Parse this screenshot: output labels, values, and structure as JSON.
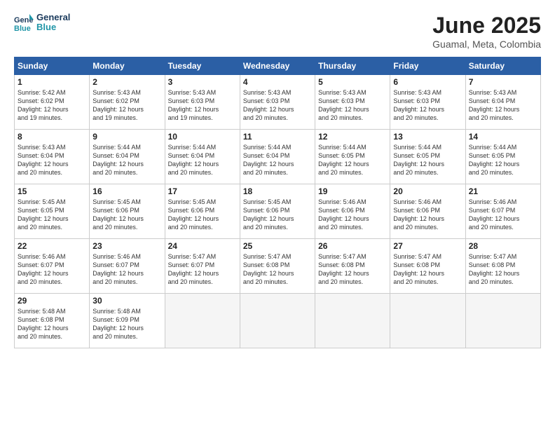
{
  "logo": {
    "line1": "General",
    "line2": "Blue"
  },
  "title": "June 2025",
  "location": "Guamal, Meta, Colombia",
  "weekdays": [
    "Sunday",
    "Monday",
    "Tuesday",
    "Wednesday",
    "Thursday",
    "Friday",
    "Saturday"
  ],
  "weeks": [
    [
      {
        "day": "1",
        "text": "Sunrise: 5:42 AM\nSunset: 6:02 PM\nDaylight: 12 hours\nand 19 minutes."
      },
      {
        "day": "2",
        "text": "Sunrise: 5:43 AM\nSunset: 6:02 PM\nDaylight: 12 hours\nand 19 minutes."
      },
      {
        "day": "3",
        "text": "Sunrise: 5:43 AM\nSunset: 6:03 PM\nDaylight: 12 hours\nand 19 minutes."
      },
      {
        "day": "4",
        "text": "Sunrise: 5:43 AM\nSunset: 6:03 PM\nDaylight: 12 hours\nand 20 minutes."
      },
      {
        "day": "5",
        "text": "Sunrise: 5:43 AM\nSunset: 6:03 PM\nDaylight: 12 hours\nand 20 minutes."
      },
      {
        "day": "6",
        "text": "Sunrise: 5:43 AM\nSunset: 6:03 PM\nDaylight: 12 hours\nand 20 minutes."
      },
      {
        "day": "7",
        "text": "Sunrise: 5:43 AM\nSunset: 6:04 PM\nDaylight: 12 hours\nand 20 minutes."
      }
    ],
    [
      {
        "day": "8",
        "text": "Sunrise: 5:43 AM\nSunset: 6:04 PM\nDaylight: 12 hours\nand 20 minutes."
      },
      {
        "day": "9",
        "text": "Sunrise: 5:44 AM\nSunset: 6:04 PM\nDaylight: 12 hours\nand 20 minutes."
      },
      {
        "day": "10",
        "text": "Sunrise: 5:44 AM\nSunset: 6:04 PM\nDaylight: 12 hours\nand 20 minutes."
      },
      {
        "day": "11",
        "text": "Sunrise: 5:44 AM\nSunset: 6:04 PM\nDaylight: 12 hours\nand 20 minutes."
      },
      {
        "day": "12",
        "text": "Sunrise: 5:44 AM\nSunset: 6:05 PM\nDaylight: 12 hours\nand 20 minutes."
      },
      {
        "day": "13",
        "text": "Sunrise: 5:44 AM\nSunset: 6:05 PM\nDaylight: 12 hours\nand 20 minutes."
      },
      {
        "day": "14",
        "text": "Sunrise: 5:44 AM\nSunset: 6:05 PM\nDaylight: 12 hours\nand 20 minutes."
      }
    ],
    [
      {
        "day": "15",
        "text": "Sunrise: 5:45 AM\nSunset: 6:05 PM\nDaylight: 12 hours\nand 20 minutes."
      },
      {
        "day": "16",
        "text": "Sunrise: 5:45 AM\nSunset: 6:06 PM\nDaylight: 12 hours\nand 20 minutes."
      },
      {
        "day": "17",
        "text": "Sunrise: 5:45 AM\nSunset: 6:06 PM\nDaylight: 12 hours\nand 20 minutes."
      },
      {
        "day": "18",
        "text": "Sunrise: 5:45 AM\nSunset: 6:06 PM\nDaylight: 12 hours\nand 20 minutes."
      },
      {
        "day": "19",
        "text": "Sunrise: 5:46 AM\nSunset: 6:06 PM\nDaylight: 12 hours\nand 20 minutes."
      },
      {
        "day": "20",
        "text": "Sunrise: 5:46 AM\nSunset: 6:06 PM\nDaylight: 12 hours\nand 20 minutes."
      },
      {
        "day": "21",
        "text": "Sunrise: 5:46 AM\nSunset: 6:07 PM\nDaylight: 12 hours\nand 20 minutes."
      }
    ],
    [
      {
        "day": "22",
        "text": "Sunrise: 5:46 AM\nSunset: 6:07 PM\nDaylight: 12 hours\nand 20 minutes."
      },
      {
        "day": "23",
        "text": "Sunrise: 5:46 AM\nSunset: 6:07 PM\nDaylight: 12 hours\nand 20 minutes."
      },
      {
        "day": "24",
        "text": "Sunrise: 5:47 AM\nSunset: 6:07 PM\nDaylight: 12 hours\nand 20 minutes."
      },
      {
        "day": "25",
        "text": "Sunrise: 5:47 AM\nSunset: 6:08 PM\nDaylight: 12 hours\nand 20 minutes."
      },
      {
        "day": "26",
        "text": "Sunrise: 5:47 AM\nSunset: 6:08 PM\nDaylight: 12 hours\nand 20 minutes."
      },
      {
        "day": "27",
        "text": "Sunrise: 5:47 AM\nSunset: 6:08 PM\nDaylight: 12 hours\nand 20 minutes."
      },
      {
        "day": "28",
        "text": "Sunrise: 5:47 AM\nSunset: 6:08 PM\nDaylight: 12 hours\nand 20 minutes."
      }
    ],
    [
      {
        "day": "29",
        "text": "Sunrise: 5:48 AM\nSunset: 6:08 PM\nDaylight: 12 hours\nand 20 minutes."
      },
      {
        "day": "30",
        "text": "Sunrise: 5:48 AM\nSunset: 6:09 PM\nDaylight: 12 hours\nand 20 minutes."
      },
      {
        "day": "",
        "text": ""
      },
      {
        "day": "",
        "text": ""
      },
      {
        "day": "",
        "text": ""
      },
      {
        "day": "",
        "text": ""
      },
      {
        "day": "",
        "text": ""
      }
    ]
  ]
}
